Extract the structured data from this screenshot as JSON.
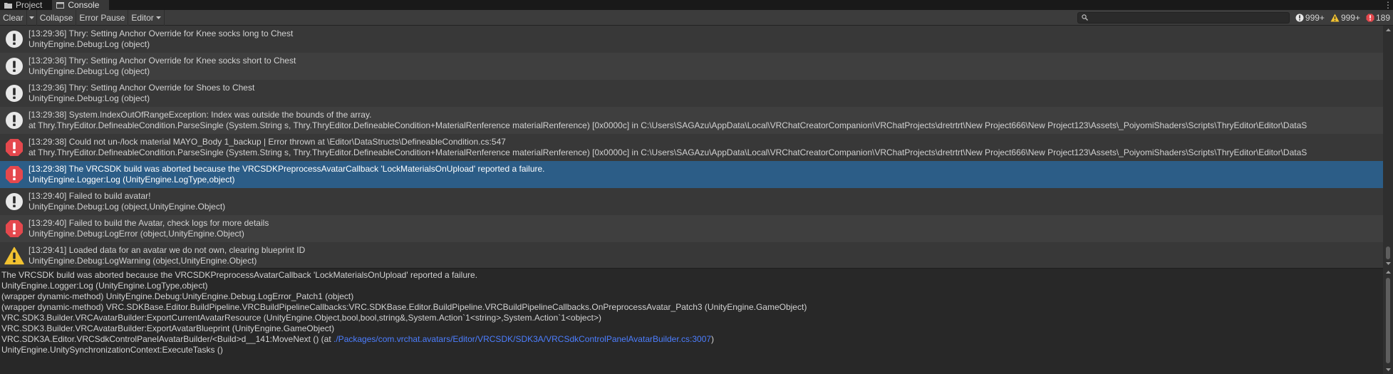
{
  "tabs": [
    {
      "label": "Project",
      "icon": "folder-icon",
      "active": false
    },
    {
      "label": "Console",
      "icon": "console-icon",
      "active": true
    }
  ],
  "toolbar": {
    "clear_label": "Clear",
    "collapse_label": "Collapse",
    "error_pause_label": "Error Pause",
    "editor_label": "Editor",
    "search_value": "",
    "search_placeholder": "",
    "info_count": "999+",
    "warning_count": "999+",
    "error_count": "189"
  },
  "colors": {
    "info_icon": "#e8e8e8",
    "warning_icon": "#f2c230",
    "error_icon": "#e5484d",
    "selected_row": "#2c5d87",
    "trace_link": "#4c7eff"
  },
  "log_entries": [
    {
      "type": "info",
      "line1": "[13:29:36] Thry: Setting Anchor Override for Knee socks long to Chest",
      "line2": "UnityEngine.Debug:Log (object)",
      "selected": false
    },
    {
      "type": "info",
      "line1": "[13:29:36] Thry: Setting Anchor Override for Knee socks short to Chest",
      "line2": "UnityEngine.Debug:Log (object)",
      "selected": false
    },
    {
      "type": "info",
      "line1": "[13:29:36] Thry: Setting Anchor Override for Shoes to Chest",
      "line2": "UnityEngine.Debug:Log (object)",
      "selected": false
    },
    {
      "type": "info",
      "line1": "[13:29:38] System.IndexOutOfRangeException: Index was outside the bounds of the array.",
      "line2": "  at Thry.ThryEditor.DefineableCondition.ParseSingle (System.String s, Thry.ThryEditor.DefineableCondition+MaterialRenference materialRenference) [0x0000c] in C:\\Users\\SAGAzu\\AppData\\Local\\VRChatCreatorCompanion\\VRChatProjects\\dretrtrt\\New Project666\\New Project123\\Assets\\_PoiyomiShaders\\Scripts\\ThryEditor\\Editor\\DataS",
      "selected": false
    },
    {
      "type": "error",
      "line1": "[13:29:38] Could not un-/lock material MAYO_Body 1_backup | Error thrown at \\Editor\\DataStructs\\DefineableCondition.cs:547",
      "line2": "  at Thry.ThryEditor.DefineableCondition.ParseSingle (System.String s, Thry.ThryEditor.DefineableCondition+MaterialRenference materialRenference) [0x0000c] in C:\\Users\\SAGAzu\\AppData\\Local\\VRChatCreatorCompanion\\VRChatProjects\\dretrtrt\\New Project666\\New Project123\\Assets\\_PoiyomiShaders\\Scripts\\ThryEditor\\Editor\\DataS",
      "selected": false
    },
    {
      "type": "error",
      "line1": "[13:29:38] The VRCSDK build was aborted because the VRCSDKPreprocessAvatarCallback 'LockMaterialsOnUpload' reported a failure.",
      "line2": "UnityEngine.Logger:Log (UnityEngine.LogType,object)",
      "selected": true
    },
    {
      "type": "info",
      "line1": "[13:29:40] Failed to build avatar!",
      "line2": "UnityEngine.Debug:Log (object,UnityEngine.Object)",
      "selected": false
    },
    {
      "type": "error",
      "line1": "[13:29:40] Failed to build the Avatar, check logs for more details",
      "line2": "UnityEngine.Debug:LogError (object,UnityEngine.Object)",
      "selected": false
    },
    {
      "type": "warning",
      "line1": "[13:29:41] Loaded data for an avatar we do not own, clearing blueprint ID",
      "line2": "UnityEngine.Debug:LogWarning (object,UnityEngine.Object)",
      "selected": false
    }
  ],
  "detail": {
    "lines": [
      "The VRCSDK build was aborted because the VRCSDKPreprocessAvatarCallback 'LockMaterialsOnUpload' reported a failure.",
      "UnityEngine.Logger:Log (UnityEngine.LogType,object)",
      "(wrapper dynamic-method) UnityEngine.Debug:UnityEngine.Debug.LogError_Patch1 (object)",
      "(wrapper dynamic-method) VRC.SDKBase.Editor.BuildPipeline.VRCBuildPipelineCallbacks:VRC.SDKBase.Editor.BuildPipeline.VRCBuildPipelineCallbacks.OnPreprocessAvatar_Patch3 (UnityEngine.GameObject)",
      "VRC.SDK3.Builder.VRCAvatarBuilder:ExportCurrentAvatarResource (UnityEngine.Object,bool,bool,string&,System.Action`1<string>,System.Action`1<object>)",
      "VRC.SDK3.Builder.VRCAvatarBuilder:ExportAvatarBlueprint (UnityEngine.GameObject)"
    ],
    "link_line_prefix": "VRC.SDK3A.Editor.VRCSdkControlPanelAvatarBuilder/<Build>d__141:MoveNext () (at ",
    "link_text": "./Packages/com.vrchat.avatars/Editor/VRCSDK/SDK3A/VRCSdkControlPanelAvatarBuilder.cs:3007",
    "link_line_suffix": ")",
    "last_line": "UnityEngine.UnitySynchronizationContext:ExecuteTasks ()"
  }
}
